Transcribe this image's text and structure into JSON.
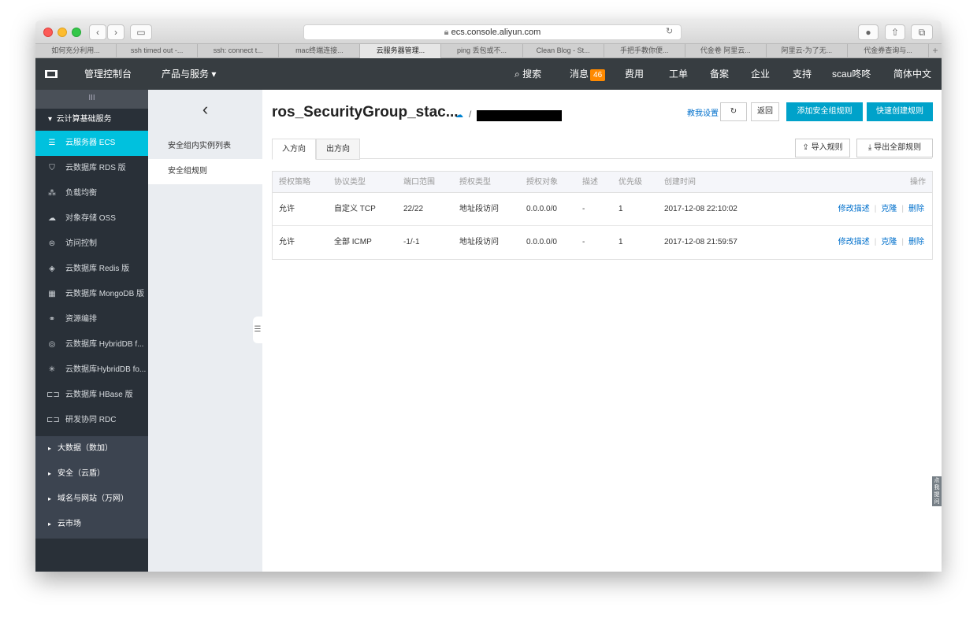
{
  "browser": {
    "url": "ecs.console.aliyun.com",
    "tabs": [
      "如何充分利用...",
      "ssh timed out -...",
      "ssh: connect t...",
      "mac终端连接...",
      "云服务器管理...",
      "ping 丢包或不...",
      "Clean Blog - St...",
      "手把手教你便...",
      "代金卷 阿里云...",
      "阿里云-为了无...",
      "代金券查询与..."
    ],
    "active_tab": 4
  },
  "topnav": {
    "logo": "C-J",
    "console": "管理控制台",
    "products": "产品与服务 ▾",
    "search": "搜索",
    "messages": "消息",
    "message_count": "46",
    "billing": "费用",
    "tickets": "工单",
    "record": "备案",
    "enterprise": "企业",
    "support": "支持",
    "user": "scau咚咚",
    "language": "简体中文"
  },
  "sidebar": {
    "handle": "III",
    "group": "云计算基础服务",
    "items": [
      {
        "label": "云服务器 ECS",
        "icon": "server-icon"
      },
      {
        "label": "云数据库 RDS 版",
        "icon": "database-icon"
      },
      {
        "label": "负载均衡",
        "icon": "load-balancer-icon"
      },
      {
        "label": "对象存储 OSS",
        "icon": "cloud-storage-icon"
      },
      {
        "label": "访问控制",
        "icon": "access-control-icon"
      },
      {
        "label": "云数据库 Redis 版",
        "icon": "redis-icon"
      },
      {
        "label": "云数据库 MongoDB 版",
        "icon": "mongodb-icon"
      },
      {
        "label": "资源编排",
        "icon": "orchestration-icon"
      },
      {
        "label": "云数据库 HybridDB f...",
        "icon": "hybriddb-icon"
      },
      {
        "label": "云数据库HybridDB fo...",
        "icon": "hybriddb-mysql-icon"
      },
      {
        "label": "云数据库 HBase 版",
        "icon": "hbase-icon"
      },
      {
        "label": "研发协同 RDC",
        "icon": "rdc-icon"
      }
    ],
    "lower_groups": [
      "大数据（数加）",
      "安全（云盾）",
      "域名与网站（万网）",
      "云市场"
    ]
  },
  "subnav": {
    "back": "‹",
    "items": [
      "安全组内实例列表",
      "安全组规则"
    ]
  },
  "main": {
    "title": "ros_SecurityGroup_stac...",
    "help_link": "教我设置",
    "refresh": "↻",
    "back_btn": "返回",
    "add_rule_btn": "添加安全组规则",
    "quick_rule_btn": "快速创建规则",
    "tab_in": "入方向",
    "tab_out": "出方向",
    "import_btn": "导入规则",
    "export_btn": "导出全部规则",
    "columns": [
      "授权策略",
      "协议类型",
      "端口范围",
      "授权类型",
      "授权对象",
      "描述",
      "优先级",
      "创建时间",
      "操作"
    ],
    "rows": [
      {
        "policy": "允许",
        "protocol": "自定义 TCP",
        "ports": "22/22",
        "auth_type": "地址段访问",
        "auth_obj": "0.0.0.0/0",
        "desc": "-",
        "priority": "1",
        "created": "2017-12-08 22:10:02"
      },
      {
        "policy": "允许",
        "protocol": "全部 ICMP",
        "ports": "-1/-1",
        "auth_type": "地址段访问",
        "auth_obj": "0.0.0.0/0",
        "desc": "-",
        "priority": "1",
        "created": "2017-12-08 21:59:57"
      }
    ],
    "op_edit": "修改描述",
    "op_clone": "克隆",
    "op_delete": "删除"
  },
  "side_help": "点我提问",
  "colors": {
    "accent": "#00c1de",
    "primary_btn": "#00a2ca",
    "topnav": "#373d41",
    "sidebar": "#293038",
    "badge": "#ff8a00",
    "link": "#0070cc"
  }
}
